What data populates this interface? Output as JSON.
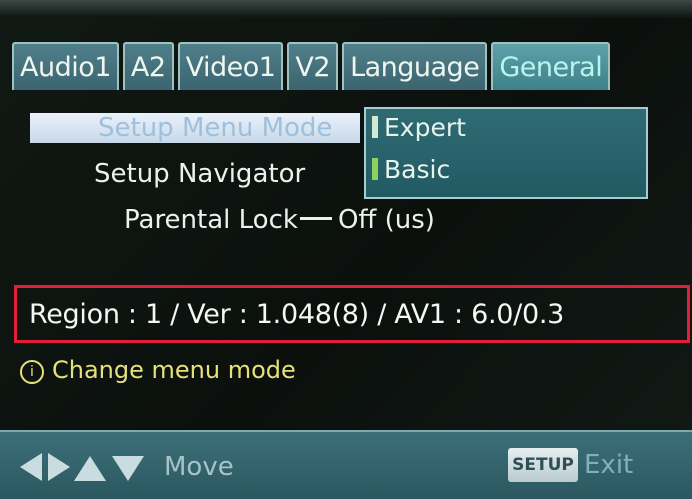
{
  "tabs": [
    {
      "label": "Audio1",
      "active": false
    },
    {
      "label": "A2",
      "active": false
    },
    {
      "label": "Video1",
      "active": false
    },
    {
      "label": "V2",
      "active": false
    },
    {
      "label": "Language",
      "active": false
    },
    {
      "label": "General",
      "active": true
    }
  ],
  "menu": {
    "items": [
      {
        "label": "Setup Menu Mode",
        "selected": true
      },
      {
        "label": "Setup Navigator"
      },
      {
        "label": "Parental Lock",
        "value": "Off (us)"
      }
    ],
    "options": [
      {
        "label": "Expert"
      },
      {
        "label": "Basic"
      }
    ]
  },
  "info_line": "Region : 1 / Ver : 1.048(8)  / AV1 : 6.0/0.3",
  "hint": "Change menu mode",
  "footer": {
    "move_label": "Move",
    "setup_key": "SETUP",
    "exit_label": "Exit"
  },
  "colors": {
    "highlight_border": "#e21e3a",
    "hint_text": "#e6e07c",
    "tab_bg": "#4f7f8a"
  }
}
